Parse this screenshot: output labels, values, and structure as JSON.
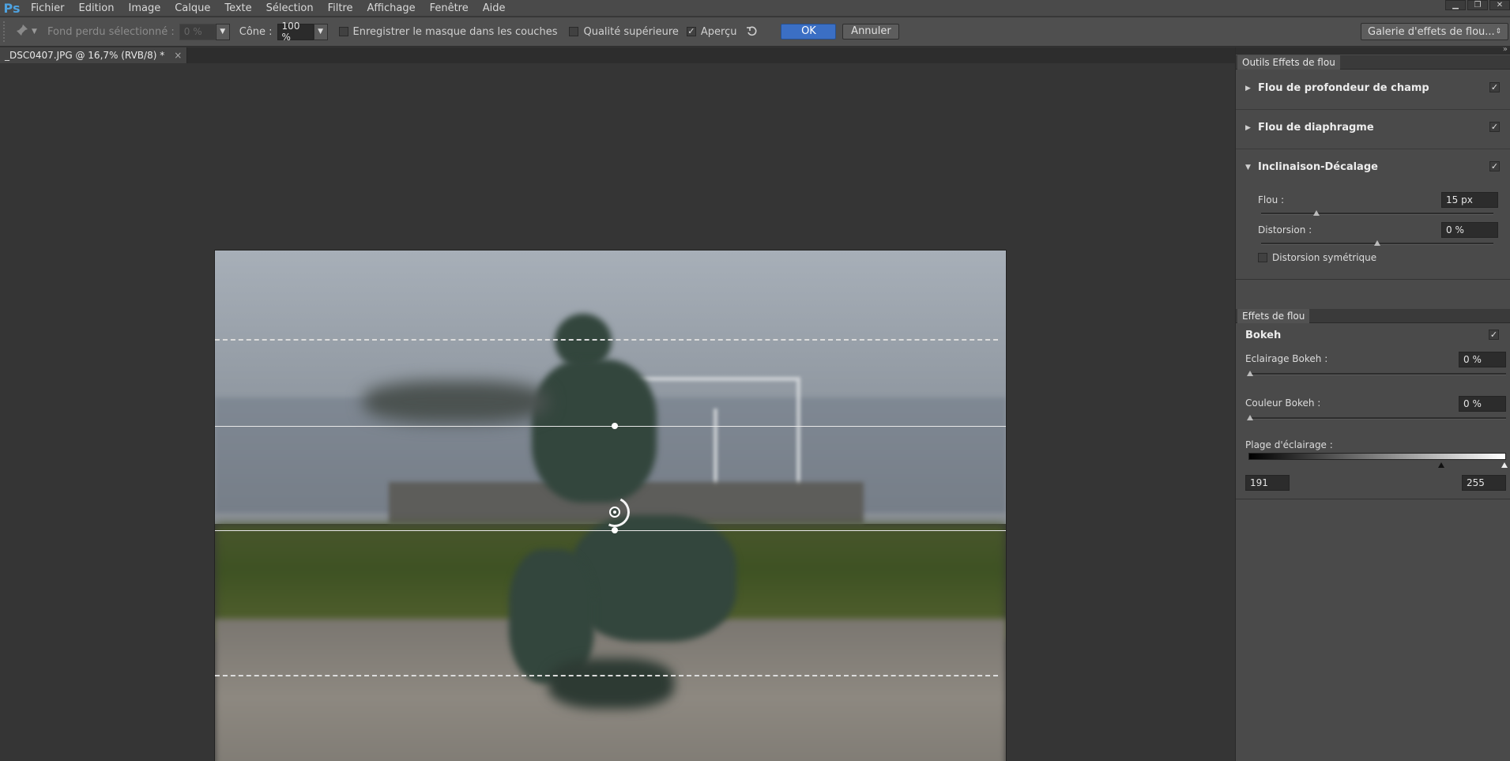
{
  "app": {
    "logo": "Ps"
  },
  "menu": [
    "Fichier",
    "Edition",
    "Image",
    "Calque",
    "Texte",
    "Sélection",
    "Filtre",
    "Affichage",
    "Fenêtre",
    "Aide"
  ],
  "window_controls": {
    "minimize": "▁",
    "restore": "❐",
    "close": "✕"
  },
  "options": {
    "fond_label": "Fond perdu sélectionné :",
    "fond_value": "0 %",
    "cone_label": "Cône :",
    "cone_value": "100 %",
    "save_mask_label": "Enregistrer le masque dans les couches",
    "save_mask_checked": false,
    "quality_label": "Qualité supérieure",
    "quality_checked": false,
    "preview_label": "Aperçu",
    "preview_checked": true,
    "ok_label": "OK",
    "cancel_label": "Annuler",
    "gallery_label": "Galerie d'effets de flou..."
  },
  "document": {
    "tab_label": "_DSC0407.JPG @ 16,7% (RVB/8) *",
    "close": "×"
  },
  "panels": {
    "blur_tools": {
      "tab": "Outils Effets de flou",
      "sections": [
        {
          "title": "Flou de profondeur de champ",
          "expanded": false,
          "checked": true
        },
        {
          "title": "Flou de diaphragme",
          "expanded": false,
          "checked": true
        },
        {
          "title": "Inclinaison-Décalage",
          "expanded": true,
          "checked": true
        }
      ],
      "tilt": {
        "flou_label": "Flou :",
        "flou_value": "15 px",
        "flou_level": 0.24,
        "distortion_label": "Distorsion :",
        "distortion_value": "0 %",
        "distortion_level": 0.5,
        "symmetric_label": "Distorsion symétrique",
        "symmetric_checked": false
      }
    },
    "blur_effects": {
      "tab": "Effets de flou",
      "bokeh_title": "Bokeh",
      "bokeh_checked": true,
      "bokeh_light_label": "Eclairage Bokeh :",
      "bokeh_light_value": "0 %",
      "bokeh_color_label": "Couleur Bokeh :",
      "bokeh_color_value": "0 %",
      "range_label": "Plage d'éclairage :",
      "range_low": "191",
      "range_high": "255",
      "range_low_level": 0.75,
      "range_high_level": 1.0
    }
  },
  "check_mark": "✓",
  "icons": {
    "pin": "pin-tool-icon",
    "reset": "reset-icon",
    "expand": "triangle-right-icon",
    "collapse": "triangle-down-icon"
  },
  "colors": {
    "accent": "#3b6fc4",
    "panel_bg": "#4a4a4a",
    "canvas_bg": "#353535"
  }
}
